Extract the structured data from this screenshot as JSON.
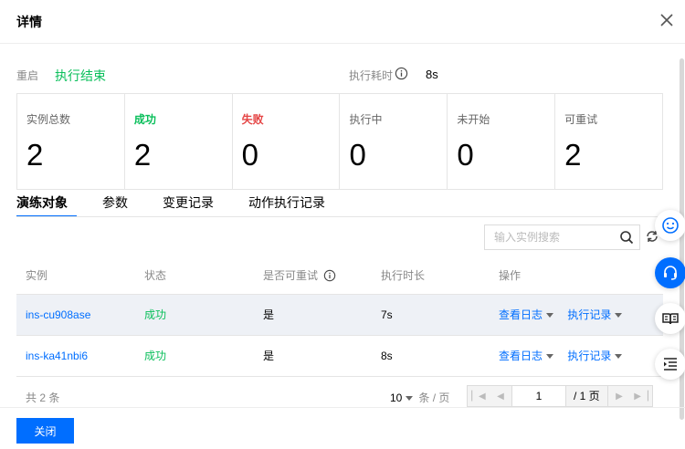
{
  "dialog": {
    "title": "详情"
  },
  "summary": {
    "restart_label": "重启",
    "restart_value": "执行结束",
    "elapsed_label": "执行耗时",
    "elapsed_value": "8s"
  },
  "stats": [
    {
      "label": "实例总数",
      "value": "2"
    },
    {
      "label": "成功",
      "value": "2"
    },
    {
      "label": "失败",
      "value": "0"
    },
    {
      "label": "执行中",
      "value": "0"
    },
    {
      "label": "未开始",
      "value": "0"
    },
    {
      "label": "可重试",
      "value": "2"
    }
  ],
  "tabs": [
    {
      "label": "演练对象"
    },
    {
      "label": "参数"
    },
    {
      "label": "变更记录"
    },
    {
      "label": "动作执行记录"
    }
  ],
  "search": {
    "placeholder": "输入实例搜索"
  },
  "table": {
    "headers": [
      "实例",
      "状态",
      "是否可重试",
      "执行时长",
      "操作"
    ],
    "rows": [
      {
        "instance": "ins-cu908ase",
        "status": "成功",
        "retry": "是",
        "duration": "7s",
        "log": "查看日志",
        "record": "执行记录"
      },
      {
        "instance": "ins-ka41nbi6",
        "status": "成功",
        "retry": "是",
        "duration": "8s",
        "log": "查看日志",
        "record": "执行记录"
      }
    ]
  },
  "pager": {
    "total": "共 2 条",
    "page_size": "10",
    "page_size_unit": "条 / 页",
    "current_page": "1",
    "page_of": "/ 1 页"
  },
  "footer": {
    "close_label": "关闭"
  },
  "colors": {
    "accent": "#006eff",
    "success": "#0abf5b",
    "danger": "#e54545"
  },
  "floating_icons": [
    "smile-icon",
    "headset-icon",
    "book-icon",
    "list-icon"
  ]
}
